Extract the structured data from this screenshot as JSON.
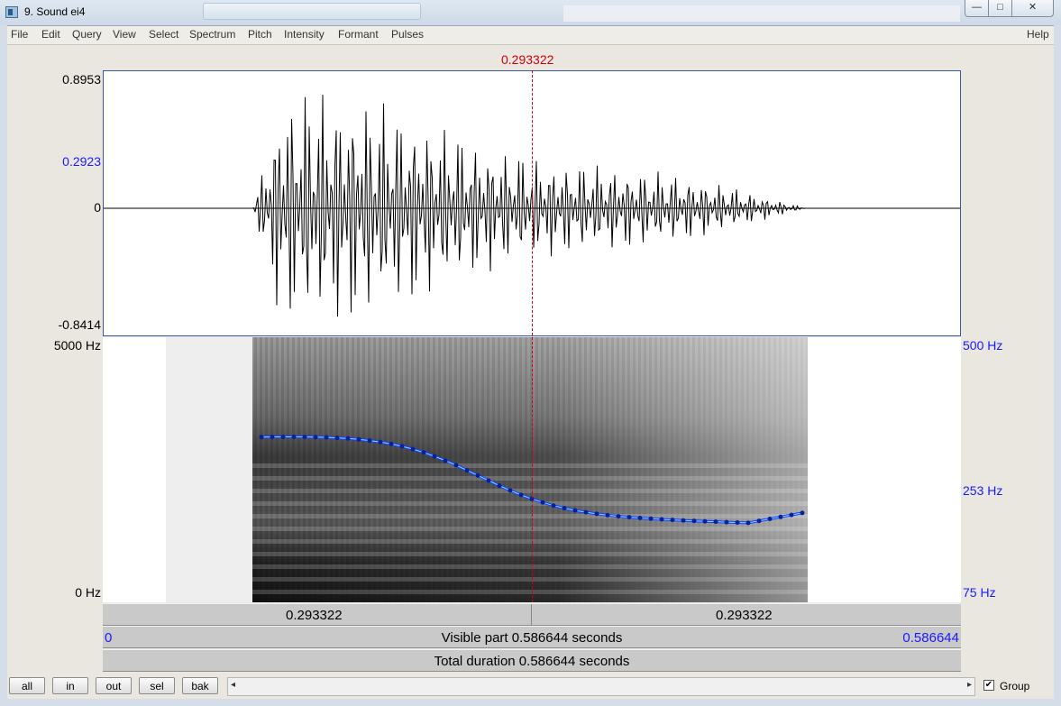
{
  "window": {
    "title": "9. Sound ei4",
    "minimize_glyph": "—",
    "maximize_glyph": "□",
    "close_glyph": "✕"
  },
  "menu": [
    "File",
    "Edit",
    "Query",
    "View",
    "Select",
    "Spectrum",
    "Pitch",
    "Intensity",
    "Formant",
    "Pulses"
  ],
  "menu_help": "Help",
  "cursor": {
    "time_label": "0.293322",
    "color": "#d0000c"
  },
  "waveform": {
    "y_max": "0.8953",
    "y_cursor": "0.2923",
    "y_zero": "0",
    "y_min": "-0.8414"
  },
  "spectrogram": {
    "freq_top": "5000 Hz",
    "freq_bottom": "0 Hz",
    "pitch_top": "500 Hz",
    "pitch_mid": "253 Hz",
    "pitch_bottom": "75 Hz",
    "pitch_color": "#1a3cff"
  },
  "time_bar": {
    "left_part": "0.293322",
    "right_part": "0.293322",
    "visible_start": "0",
    "visible_label": "Visible part 0.586644 seconds",
    "visible_end": "0.586644",
    "total_label": "Total duration 0.586644 seconds"
  },
  "nav_buttons": [
    "all",
    "in",
    "out",
    "sel",
    "bak"
  ],
  "scroll": {
    "left_arrow": "◂",
    "right_arrow": "▸"
  },
  "group": {
    "label": "Group",
    "checked": true,
    "check_glyph": "✔"
  }
}
